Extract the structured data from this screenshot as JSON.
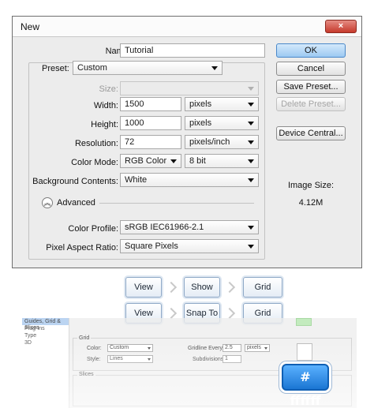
{
  "dialog": {
    "title": "New",
    "close_label": "×",
    "name_label": "Name:",
    "name_value": "Tutorial",
    "preset_label": "Preset:",
    "preset_value": "Custom",
    "size_label": "Size:",
    "size_value": "",
    "width_label": "Width:",
    "width_value": "1500",
    "width_unit": "pixels",
    "height_label": "Height:",
    "height_value": "1000",
    "height_unit": "pixels",
    "resolution_label": "Resolution:",
    "resolution_value": "72",
    "resolution_unit": "pixels/inch",
    "color_mode_label": "Color Mode:",
    "color_mode_value": "RGB Color",
    "bit_depth_value": "8 bit",
    "background_label": "Background Contents:",
    "background_value": "White",
    "advanced_label": "Advanced",
    "advanced_icon": "double-chevron-up-icon",
    "color_profile_label": "Color Profile:",
    "color_profile_value": "sRGB IEC61966-2.1",
    "pixel_aspect_label": "Pixel Aspect Ratio:",
    "pixel_aspect_value": "Square Pixels",
    "buttons": {
      "ok": "OK",
      "cancel": "Cancel",
      "save_preset": "Save Preset...",
      "delete_preset": "Delete Preset...",
      "device_central": "Device Central..."
    },
    "image_size_label": "Image Size:",
    "image_size_value": "4.12M"
  },
  "path1": [
    "View",
    "Show",
    "Grid"
  ],
  "path2": [
    "View",
    "Snap To",
    "Grid"
  ],
  "prefs": {
    "list_items": [
      "Guides, Grid & Slices",
      "Plug-Ins",
      "Type",
      "3D"
    ],
    "grid_heading": "Grid",
    "color_label": "Color:",
    "color_value": "Custom",
    "style_label": "Style:",
    "style_value": "Lines",
    "gridline_label": "Gridline Every:",
    "gridline_value": "2.5",
    "gridline_unit": "pixels",
    "subdivisions_label": "Subdivisions:",
    "subdivisions_value": "1",
    "slices_heading": "Slices"
  },
  "badge": {
    "text": "# ffffff"
  },
  "colors": {
    "ok_button": "#9cc9f2",
    "close_button": "#c63a2c",
    "badge": "#1b76d3",
    "grid_swatch": "#b3e6ad"
  }
}
